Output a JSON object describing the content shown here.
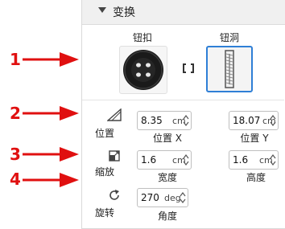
{
  "section": {
    "title": "变换"
  },
  "button_label": "钮扣",
  "hole_label": "钮洞",
  "position": {
    "label": "位置",
    "x": {
      "value": "8.35",
      "unit": "cm",
      "caption": "位置 X"
    },
    "y": {
      "value": "18.07",
      "unit": "cm",
      "caption": "位置 Y"
    }
  },
  "scale": {
    "label": "缩放",
    "width": {
      "value": "1.6",
      "unit": "cm",
      "caption": "宽度"
    },
    "height": {
      "value": "1.6",
      "unit": "cm",
      "caption": "高度"
    }
  },
  "rotation": {
    "label": "旋转",
    "angle": {
      "value": "270",
      "unit": "deg",
      "caption": "角度"
    }
  },
  "annotations": [
    "1",
    "2",
    "3",
    "4"
  ],
  "colors": {
    "arrow": "#e01010",
    "selected_border": "#2f7fd6"
  }
}
